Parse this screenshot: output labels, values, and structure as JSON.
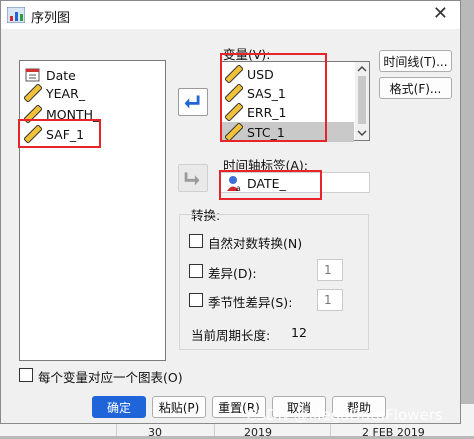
{
  "dialog": {
    "title": "序列图"
  },
  "source_list": {
    "items": [
      {
        "label": "Date",
        "icon": "date-variable-icon"
      },
      {
        "label": "YEAR_",
        "icon": "ruler-scale-icon"
      },
      {
        "label": "MONTH_",
        "icon": "ruler-scale-icon"
      },
      {
        "label": "SAF_1",
        "icon": "ruler-scale-icon"
      }
    ]
  },
  "variables": {
    "label": "变量(V):",
    "items": [
      {
        "label": "USD",
        "icon": "ruler-scale-icon"
      },
      {
        "label": "SAS_1",
        "icon": "ruler-scale-icon"
      },
      {
        "label": "ERR_1",
        "icon": "ruler-scale-icon"
      },
      {
        "label": "STC_1",
        "icon": "ruler-scale-icon",
        "selected": true
      }
    ]
  },
  "time_axis": {
    "label": "时间轴标签(A):",
    "value": "DATE_",
    "icon": "string-variable-icon"
  },
  "side_buttons": {
    "time_lines": "时间线(T)...",
    "format": "格式(F)..."
  },
  "transform": {
    "title": "转换:",
    "natural_log": "自然对数转换(N)",
    "difference": "差异(D):",
    "difference_value": "1",
    "seasonal_difference": "季节性差异(S):",
    "seasonal_value": "1",
    "period_label": "当前周期长度:",
    "period_value": "12"
  },
  "one_chart_per_variable": "每个变量对应一个图表(O)",
  "footer": {
    "ok": "确定",
    "paste": "粘贴(P)",
    "reset": "重置(R)",
    "cancel": "取消",
    "help": "帮助"
  },
  "background_sheet": {
    "cells": [
      "30",
      "2019",
      "2 FEB 2019"
    ]
  },
  "watermark": "CSDN @MegaDataFlowers",
  "colors": {
    "highlight": "#e8242b",
    "primary_button": "#1f64d8",
    "arrow_blue": "#1f64d8"
  }
}
